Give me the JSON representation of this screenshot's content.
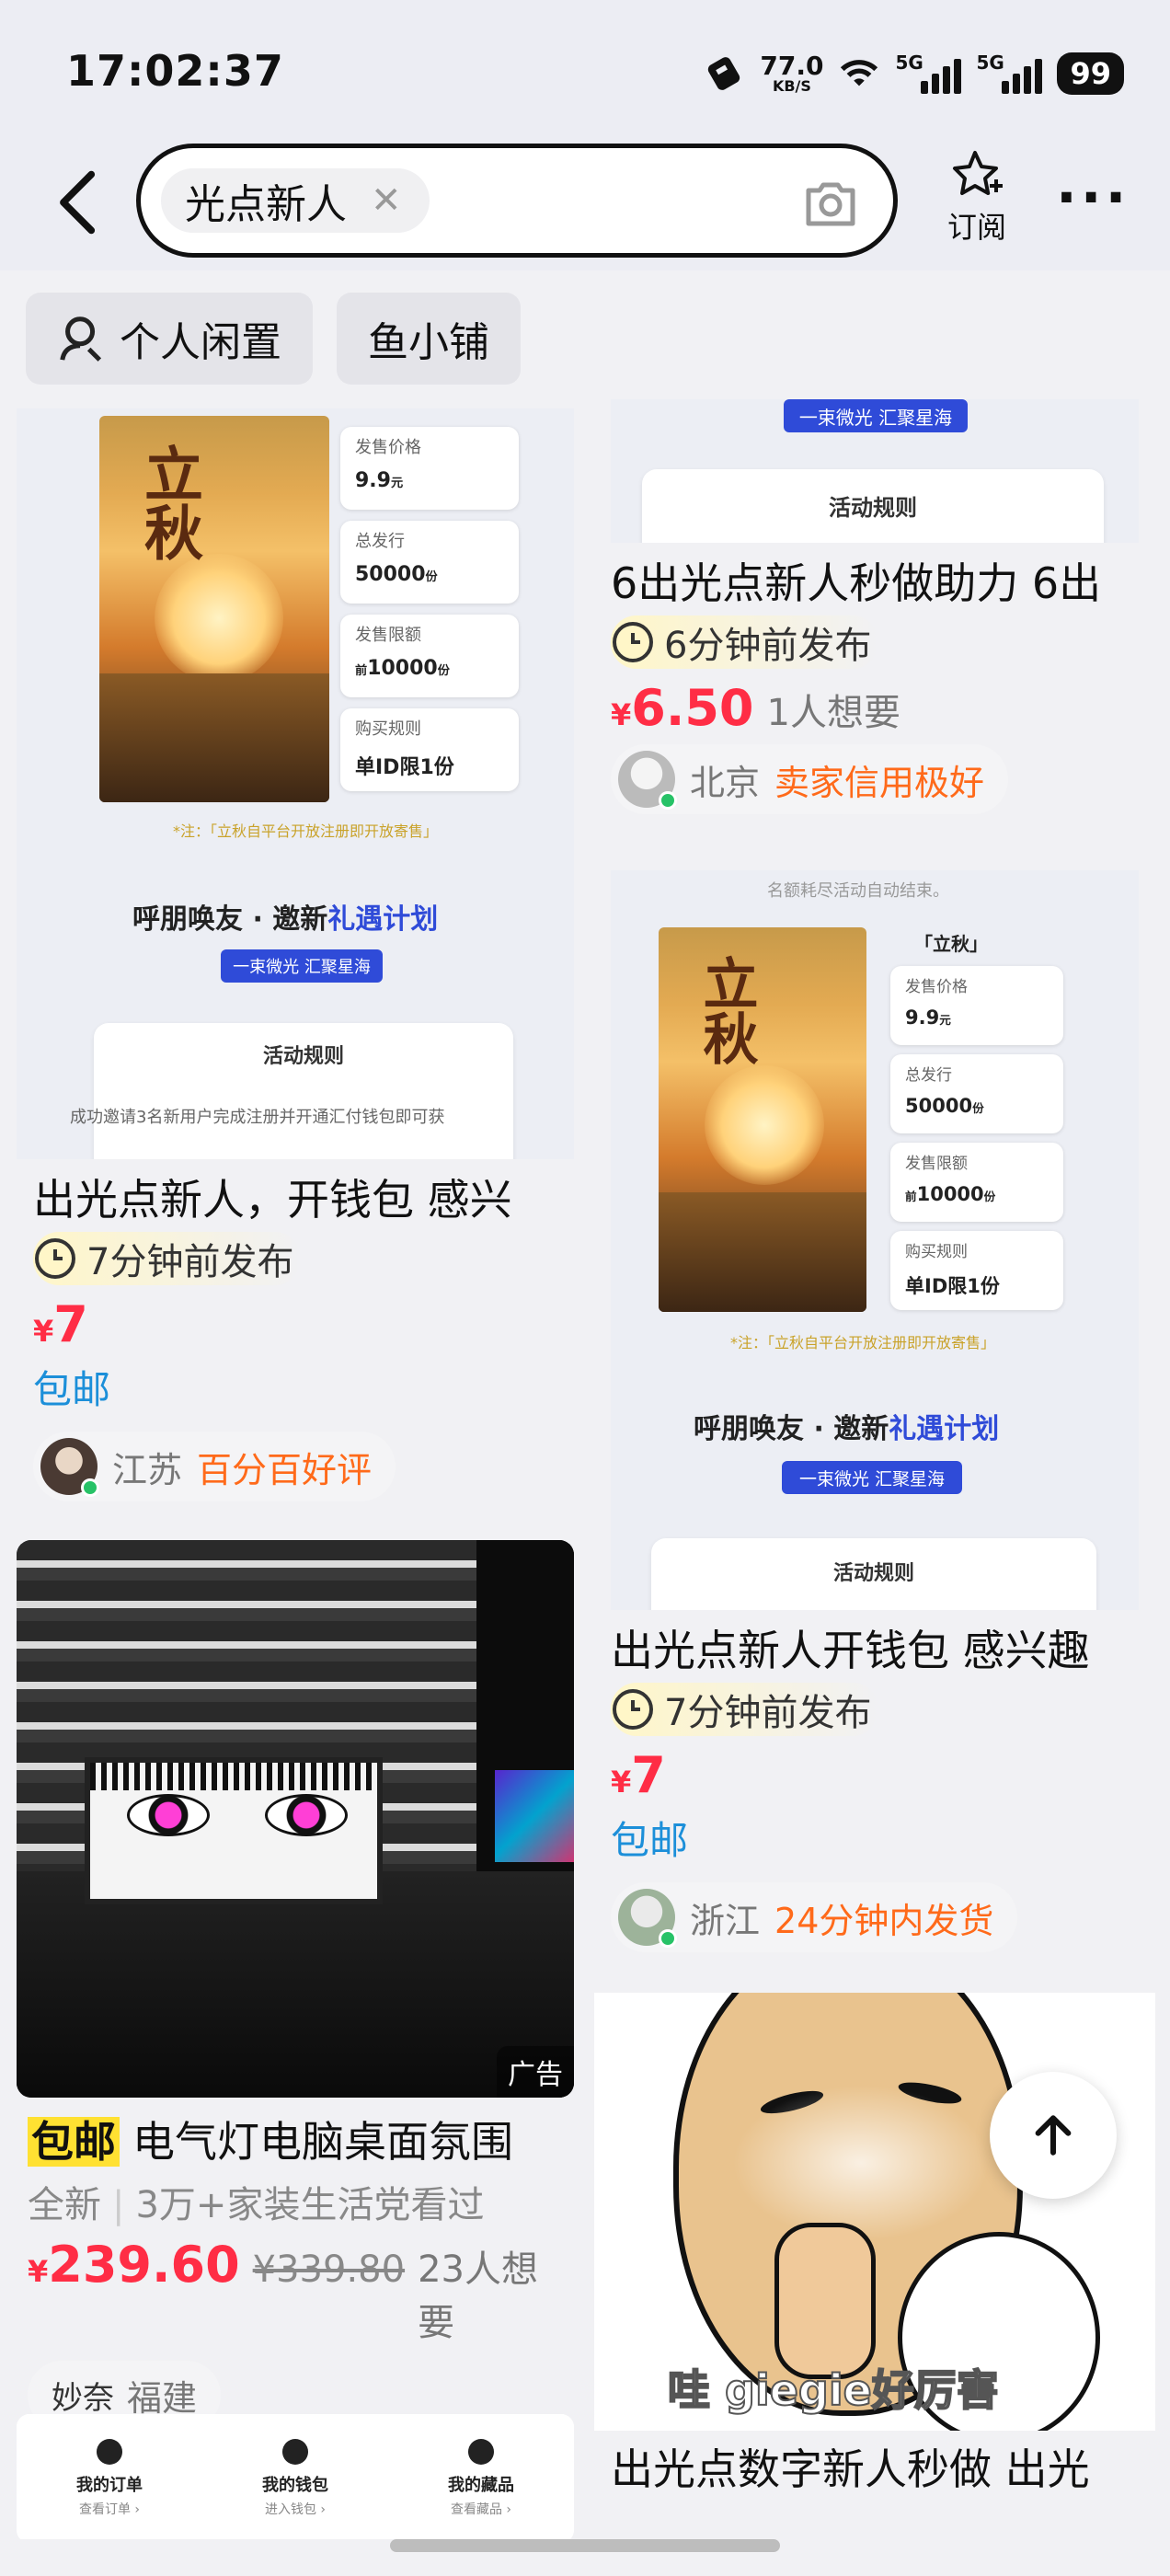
{
  "status_bar": {
    "time": "17:02:37",
    "net_speed_value": "77.0",
    "net_speed_unit": "KB/S",
    "signal1_label": "5G",
    "signal2_label": "5G",
    "battery": "99"
  },
  "header": {
    "search_chip": "光点新人",
    "subscribe_label": "订阅"
  },
  "filters": [
    {
      "label": "个人闲置"
    },
    {
      "label": "鱼小铺"
    }
  ],
  "promo_art": {
    "poster_title": "立秋",
    "price_label": "发售价格",
    "price_value": "9.9",
    "price_unit": "元",
    "total_label": "总发行",
    "total_value": "50000",
    "total_unit": "份",
    "limit_label": "发售限额",
    "limit_prefix": "前",
    "limit_value": "10000",
    "limit_unit": "份",
    "rule_label": "购买规则",
    "rule_value": "单ID限1份",
    "note": "*注：「立秋自平台开放注册即开放寄售」",
    "slogan_a": "呼朋唤友 · 邀新",
    "slogan_b": "礼遇计划",
    "bar_text": "一束微光 汇聚星海",
    "rules_title": "活动规则",
    "rules_desc": "成功邀请3名新用户完成注册并开通汇付钱包即可获",
    "top_text": "名额耗尽活动自动结束。",
    "tag": "「立秋」"
  },
  "listings": {
    "left1": {
      "title": "出光点新人，开钱包 感兴",
      "time": "7分钟前发布",
      "price": "7",
      "shipping": "包邮",
      "location": "江苏",
      "badge": "百分百好评"
    },
    "ad": {
      "ad_label": "广告",
      "free_tag": "包邮",
      "title": "电气灯电脑桌面氛围",
      "condition": "全新",
      "views": "3万+家装生活党看过",
      "price": "239.60",
      "orig_price": "¥339.80",
      "want": "23人想要",
      "seller_name": "妙奈",
      "location": "福建"
    },
    "ad_bottom_tabs": [
      {
        "label": "我的订单",
        "sub": "查看订单 ›"
      },
      {
        "label": "我的钱包",
        "sub": "进入钱包 ›"
      },
      {
        "label": "我的藏品",
        "sub": "查看藏品 ›"
      }
    ],
    "right1": {
      "title": "6出光点新人秒做助力 6出",
      "time": "6分钟前发布",
      "price": "6.50",
      "want": "1人想要",
      "location": "北京",
      "badge": "卖家信用极好"
    },
    "right2": {
      "title": "出光点新人开钱包 感兴趣",
      "time": "7分钟前发布",
      "price": "7",
      "shipping": "包邮",
      "location": "浙江",
      "badge": "24分钟内发货"
    },
    "right3": {
      "caption": "哇 giegie好厉害",
      "title": "出光点数字新人秒做 出光"
    }
  },
  "currency_symbol": "¥",
  "colors": {
    "price": "#ff2d45",
    "badge": "#ff6a1a",
    "shipping": "#1c8fd9",
    "slogan_accent": "#2f4bd8"
  }
}
